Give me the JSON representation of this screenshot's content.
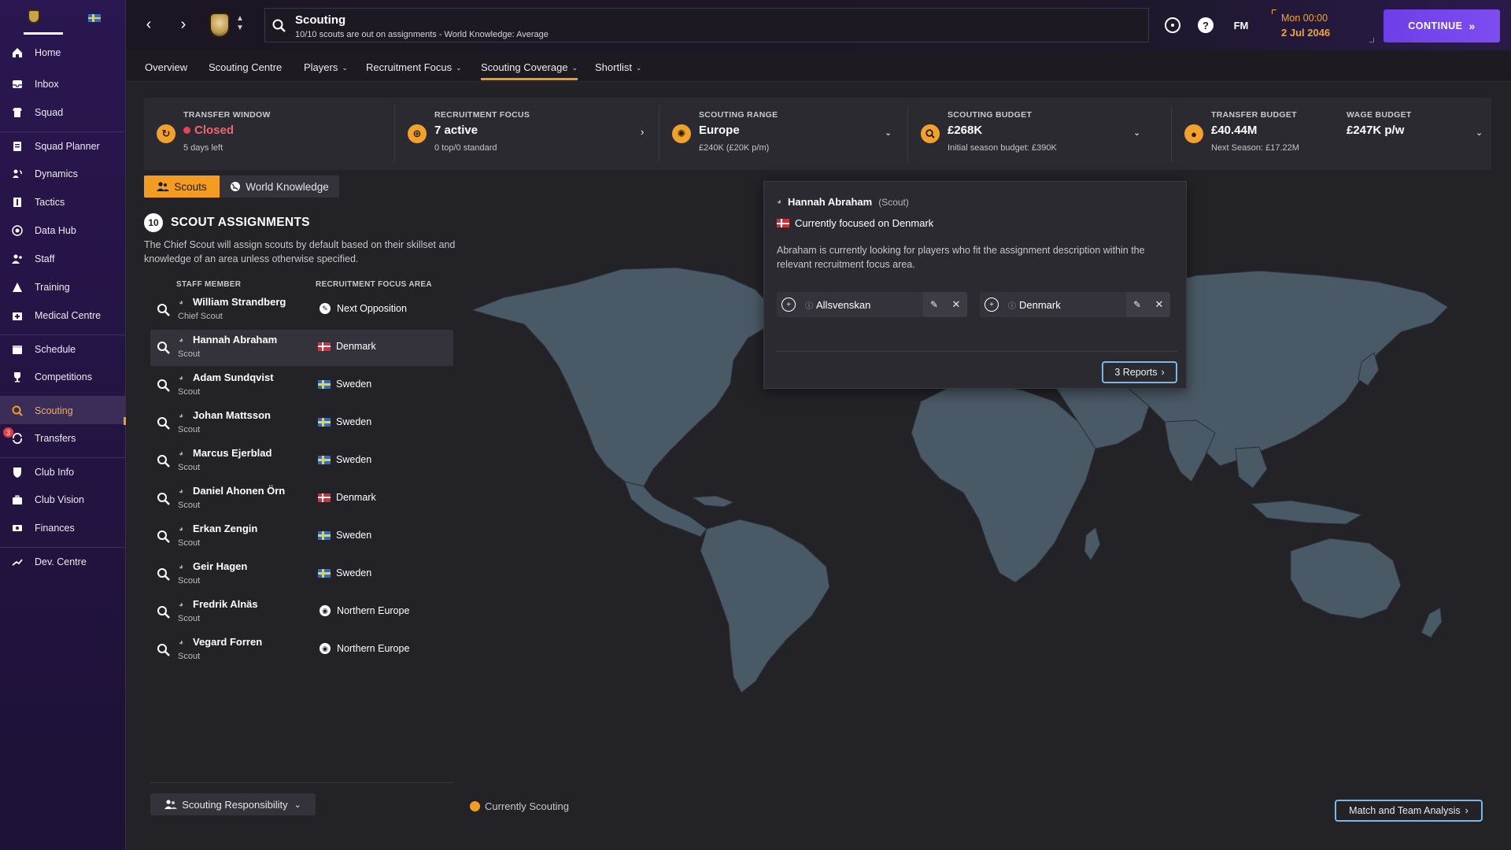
{
  "sidebar": {
    "items": [
      {
        "label": "Home",
        "icon": "home-icon"
      },
      {
        "label": "Inbox",
        "icon": "inbox-icon"
      },
      {
        "label": "Squad",
        "icon": "squad-icon"
      },
      {
        "label": "Squad Planner",
        "icon": "planner-icon"
      },
      {
        "label": "Dynamics",
        "icon": "dynamics-icon"
      },
      {
        "label": "Tactics",
        "icon": "tactics-icon"
      },
      {
        "label": "Data Hub",
        "icon": "data-hub-icon"
      },
      {
        "label": "Staff",
        "icon": "staff-icon"
      },
      {
        "label": "Training",
        "icon": "training-icon"
      },
      {
        "label": "Medical Centre",
        "icon": "medical-icon"
      },
      {
        "label": "Schedule",
        "icon": "schedule-icon"
      },
      {
        "label": "Competitions",
        "icon": "trophy-icon"
      },
      {
        "label": "Scouting",
        "icon": "scouting-icon"
      },
      {
        "label": "Transfers",
        "icon": "transfers-icon",
        "badge": "3"
      },
      {
        "label": "Club Info",
        "icon": "shield-icon"
      },
      {
        "label": "Club Vision",
        "icon": "briefcase-icon"
      },
      {
        "label": "Finances",
        "icon": "finances-icon"
      },
      {
        "label": "Dev. Centre",
        "icon": "dev-centre-icon"
      }
    ]
  },
  "header": {
    "title": "Scouting",
    "subtitle": "10/10 scouts are out on assignments - World Knowledge: Average",
    "time": "Mon 00:00",
    "date": "2 Jul 2046",
    "fm_label": "FM",
    "help_label": "?",
    "continue_label": "CONTINUE"
  },
  "tabs": [
    {
      "label": "Overview",
      "dropdown": false
    },
    {
      "label": "Scouting Centre",
      "dropdown": false
    },
    {
      "label": "Players",
      "dropdown": true
    },
    {
      "label": "Recruitment Focus",
      "dropdown": true
    },
    {
      "label": "Scouting Coverage",
      "dropdown": true,
      "active": true
    },
    {
      "label": "Shortlist",
      "dropdown": true
    }
  ],
  "summary": {
    "transfer_window": {
      "label": "TRANSFER WINDOW",
      "value": "Closed",
      "sub": "5 days left"
    },
    "recruitment_focus": {
      "label": "RECRUITMENT FOCUS",
      "value": "7 active",
      "sub": "0 top/0 standard"
    },
    "scouting_range": {
      "label": "SCOUTING RANGE",
      "value": "Europe",
      "sub": "£240K (£20K p/m)"
    },
    "scouting_budget": {
      "label": "SCOUTING BUDGET",
      "value": "£268K",
      "sub": "Initial season budget: £390K"
    },
    "transfer_budget": {
      "label": "TRANSFER BUDGET",
      "value": "£40.44M",
      "sub": "Next Season: £17.22M"
    },
    "wage_budget": {
      "label": "WAGE BUDGET",
      "value": "£247K p/w"
    }
  },
  "toggle": {
    "scouts": "Scouts",
    "world_knowledge": "World Knowledge"
  },
  "assignments": {
    "count": "10",
    "title": "SCOUT ASSIGNMENTS",
    "description": "The Chief Scout will assign scouts by default based on their skillset and knowledge of an area unless otherwise specified.",
    "col_staff": "STAFF MEMBER",
    "col_area": "RECRUITMENT FOCUS AREA",
    "rows": [
      {
        "name": "William Strandberg",
        "role": "Chief Scout",
        "area": "Next Opposition",
        "area_type": "opposition"
      },
      {
        "name": "Hannah Abraham",
        "role": "Scout",
        "area": "Denmark",
        "area_type": "dk",
        "selected": true
      },
      {
        "name": "Adam Sundqvist",
        "role": "Scout",
        "area": "Sweden",
        "area_type": "se"
      },
      {
        "name": "Johan Mattsson",
        "role": "Scout",
        "area": "Sweden",
        "area_type": "se"
      },
      {
        "name": "Marcus Ejerblad",
        "role": "Scout",
        "area": "Sweden",
        "area_type": "se"
      },
      {
        "name": "Daniel Ahonen Örn",
        "role": "Scout",
        "area": "Denmark",
        "area_type": "dk"
      },
      {
        "name": "Erkan Zengin",
        "role": "Scout",
        "area": "Sweden",
        "area_type": "se"
      },
      {
        "name": "Geir Hagen",
        "role": "Scout",
        "area": "Sweden",
        "area_type": "se"
      },
      {
        "name": "Fredrik Alnäs",
        "role": "Scout",
        "area": "Northern Europe",
        "area_type": "globe"
      },
      {
        "name": "Vegard Forren",
        "role": "Scout",
        "area": "Northern Europe",
        "area_type": "globe"
      }
    ]
  },
  "popup": {
    "name": "Hannah Abraham",
    "role": "(Scout)",
    "focus": "Currently focused on Denmark",
    "description": "Abraham is currently looking for players who fit the assignment description within the relevant recruitment focus area.",
    "chip1": "Allsvenskan",
    "chip2": "Denmark",
    "reports_label": "3 Reports"
  },
  "bottom": {
    "responsibility_label": "Scouting Responsibility",
    "legend_label": "Currently Scouting",
    "analysis_label": "Match and Team Analysis"
  },
  "colors": {
    "accent": "#f39c21",
    "continue": "#7244ea",
    "map_land": "#4a5966"
  }
}
